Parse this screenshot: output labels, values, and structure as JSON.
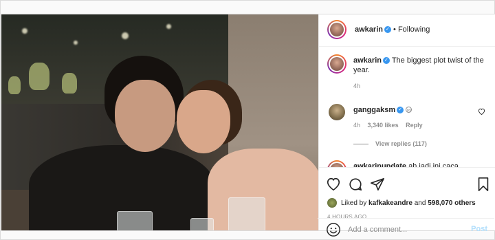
{
  "post": {
    "author": {
      "username": "awkarin",
      "verified": true,
      "follow_status": "Following"
    },
    "caption": {
      "username": "awkarin",
      "text": "The biggest plot twist of the year.",
      "time": "4h"
    },
    "comments": [
      {
        "username": "ganggaksm",
        "verified": true,
        "badge": "∞",
        "time": "4h",
        "likes": "3,340 likes",
        "reply_label": "Reply",
        "view_replies": "View replies (117)"
      },
      {
        "username_partial": "awkarinupdate",
        "text_partial": "ah jadi ini caca"
      }
    ],
    "likes": {
      "prefix": "Liked by ",
      "first_user": "kafkakeandre",
      "middle": " and ",
      "count": "598,070 others"
    },
    "timestamp": "4 HOURS AGO",
    "add_comment": {
      "placeholder": "Add a comment...",
      "post_label": "Post"
    }
  },
  "icons": {
    "like": "heart-icon",
    "comment": "comment-icon",
    "share": "paper-plane-icon",
    "save": "bookmark-icon",
    "emoji": "smiley-icon",
    "comment_like": "heart-icon"
  },
  "colors": {
    "verified": "#3897f0",
    "post_button_disabled": "#b2dffc",
    "muted_text": "#8e8e8e",
    "text": "#262626",
    "border": "#dbdbdb"
  }
}
